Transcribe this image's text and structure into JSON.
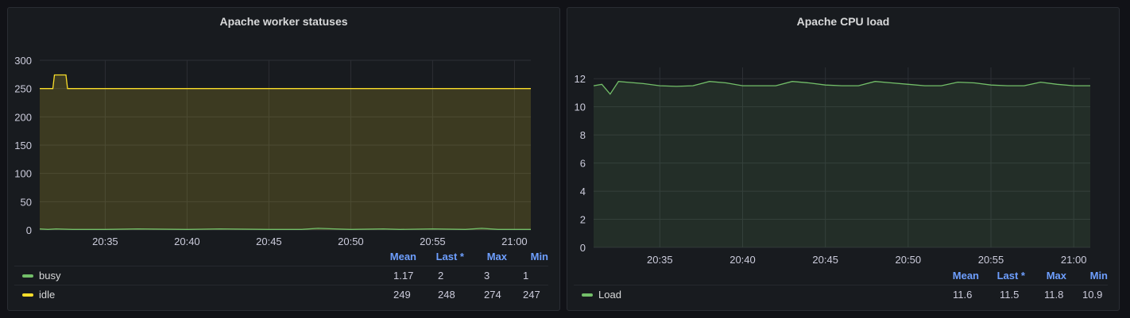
{
  "panels": [
    {
      "title": "Apache worker statuses",
      "legend_headers": [
        "Mean",
        "Last *",
        "Max",
        "Min"
      ],
      "legend": [
        {
          "name": "busy",
          "color": "#73bf69",
          "mean": "1.17",
          "last": "2",
          "max": "3",
          "min": "1"
        },
        {
          "name": "idle",
          "color": "#fade2a",
          "mean": "249",
          "last": "248",
          "max": "274",
          "min": "247"
        }
      ]
    },
    {
      "title": "Apache CPU load",
      "legend_headers": [
        "Mean",
        "Last *",
        "Max",
        "Min"
      ],
      "legend": [
        {
          "name": "Load",
          "color": "#73bf69",
          "mean": "11.6",
          "last": "11.5",
          "max": "11.8",
          "min": "10.9"
        }
      ]
    }
  ],
  "chart_data": [
    {
      "type": "area",
      "title": "Apache worker statuses",
      "x_ticks": [
        "20:35",
        "20:40",
        "20:45",
        "20:50",
        "20:55",
        "21:00"
      ],
      "y_ticks": [
        "0",
        "50",
        "100",
        "150",
        "200",
        "250",
        "300"
      ],
      "xlim": [
        "20:31",
        "21:01"
      ],
      "ylim": [
        0,
        300
      ],
      "grid": true,
      "legend_placement": "bottom",
      "series": [
        {
          "name": "idle",
          "color": "#fade2a",
          "x": [
            "20:31",
            "20:31.8",
            "20:31.9",
            "20:32.6",
            "20:32.7",
            "21:01"
          ],
          "y": [
            250,
            250,
            274,
            274,
            250,
            250
          ]
        },
        {
          "name": "busy",
          "color": "#73bf69",
          "x": [
            "20:31",
            "20:31.5",
            "20:32",
            "20:33",
            "20:35",
            "20:37",
            "20:40",
            "20:42",
            "20:45",
            "20:47",
            "20:48",
            "20:49",
            "20:50",
            "20:52",
            "20:53",
            "20:55",
            "20:57",
            "20:58",
            "20:59",
            "21:01"
          ],
          "y": [
            2,
            1,
            2,
            1,
            1,
            2,
            1,
            2,
            1,
            1,
            3,
            2,
            1,
            2,
            1,
            2,
            1,
            3,
            1,
            1
          ]
        }
      ]
    },
    {
      "type": "area",
      "title": "Apache CPU load",
      "x_ticks": [
        "20:35",
        "20:40",
        "20:45",
        "20:50",
        "20:55",
        "21:00"
      ],
      "y_ticks": [
        "0",
        "2",
        "4",
        "6",
        "8",
        "10",
        "12"
      ],
      "xlim": [
        "20:31",
        "21:01"
      ],
      "ylim": [
        0,
        12.8
      ],
      "grid": true,
      "legend_placement": "bottom",
      "series": [
        {
          "name": "Load",
          "color": "#73bf69",
          "x": [
            "20:31",
            "20:31.5",
            "20:32",
            "20:32.5",
            "20:33",
            "20:34",
            "20:35",
            "20:36",
            "20:37",
            "20:38",
            "20:39",
            "20:40",
            "20:41",
            "20:42",
            "20:43",
            "20:44",
            "20:45",
            "20:46",
            "20:47",
            "20:48",
            "20:49",
            "20:50",
            "20:51",
            "20:52",
            "20:53",
            "20:54",
            "20:55",
            "20:56",
            "20:57",
            "20:58",
            "20:59",
            "21:00",
            "21:01"
          ],
          "y": [
            11.5,
            11.6,
            10.9,
            11.8,
            11.75,
            11.65,
            11.5,
            11.45,
            11.5,
            11.8,
            11.7,
            11.5,
            11.5,
            11.5,
            11.8,
            11.7,
            11.55,
            11.5,
            11.5,
            11.8,
            11.7,
            11.6,
            11.5,
            11.5,
            11.75,
            11.7,
            11.55,
            11.5,
            11.5,
            11.75,
            11.6,
            11.5,
            11.5
          ]
        }
      ]
    }
  ]
}
